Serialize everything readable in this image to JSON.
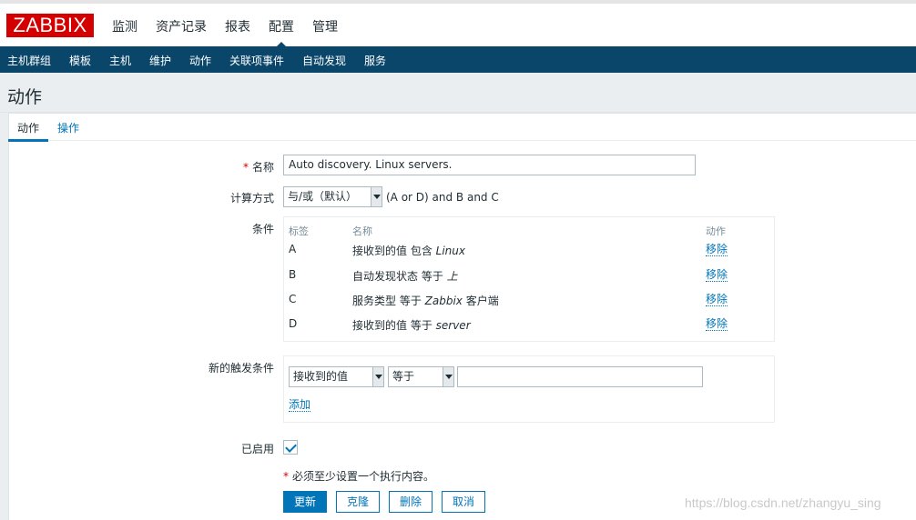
{
  "header": {
    "logo": "ZABBIX",
    "nav": [
      "监测",
      "资产记录",
      "报表",
      "配置",
      "管理"
    ],
    "active_nav": "配置"
  },
  "subnav": [
    "主机群组",
    "模板",
    "主机",
    "维护",
    "动作",
    "关联项事件",
    "自动发现",
    "服务"
  ],
  "page_title": "动作",
  "tabs": [
    "动作",
    "操作"
  ],
  "form": {
    "name_label": "名称",
    "name_value": "Auto discovery. Linux servers.",
    "calc_label": "计算方式",
    "calc_value": "与/或（默认）",
    "calc_expression": "(A or D) and B and C",
    "conditions_label": "条件",
    "conditions_headers": {
      "label": "标签",
      "name": "名称",
      "action": "动作"
    },
    "conditions": [
      {
        "label": "A",
        "prefix": "接收到的值 包含 ",
        "value": "Linux",
        "suffix": "",
        "action": "移除"
      },
      {
        "label": "B",
        "prefix": "自动发现状态 等于 ",
        "value": "上",
        "suffix": "",
        "action": "移除"
      },
      {
        "label": "C",
        "prefix": "服务类型 等于 ",
        "value": "Zabbix",
        "suffix": " 客户端",
        "action": "移除"
      },
      {
        "label": "D",
        "prefix": "接收到的值 等于 ",
        "value": "server",
        "suffix": "",
        "action": "移除"
      }
    ],
    "new_condition_label": "新的触发条件",
    "new_condition_type": "接收到的值",
    "new_condition_operator": "等于",
    "new_condition_value": "",
    "add_link": "添加",
    "enabled_label": "已启用",
    "enabled": true,
    "note": "必须至少设置一个执行内容。",
    "required_mark": "*"
  },
  "buttons": {
    "update": "更新",
    "clone": "克隆",
    "delete": "删除",
    "cancel": "取消"
  },
  "watermark": "https://blog.csdn.net/zhangyu_sing",
  "colors": {
    "brand": "#d40000",
    "nav_bg": "#0a466a",
    "accent": "#0275b8"
  }
}
